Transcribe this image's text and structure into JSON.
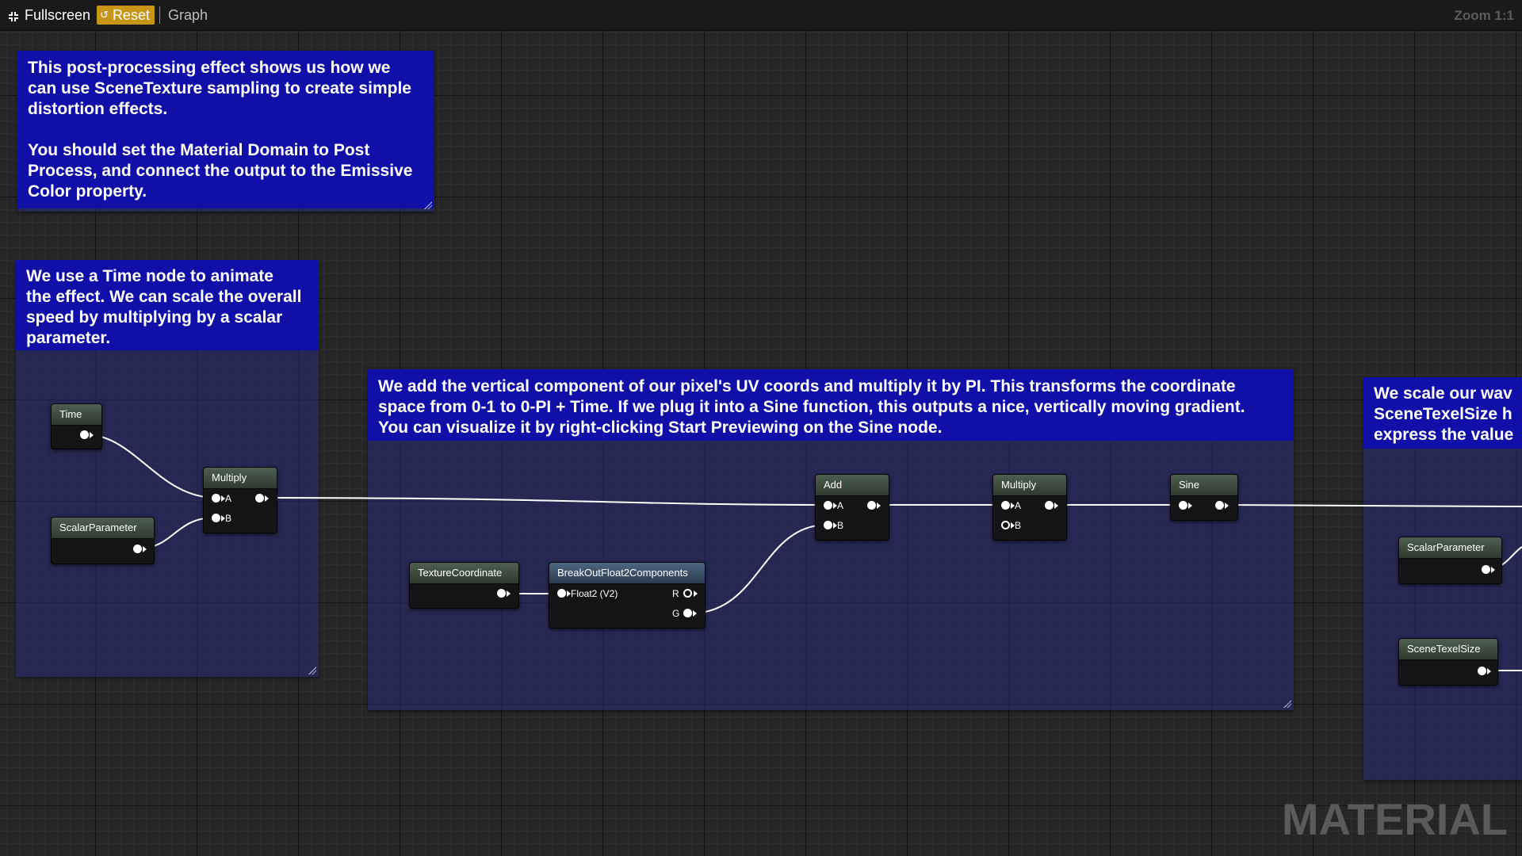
{
  "toolbar": {
    "fullscreen_label": "Fullscreen",
    "reset_label": "Reset",
    "graph_label": "Graph",
    "zoom_label": "Zoom 1:1"
  },
  "comments": {
    "intro": "This post-processing effect shows us how we\ncan use SceneTexture sampling to create simple\ndistortion effects.\n\nYou should set the Material Domain to Post\nProcess, and connect the output to the Emissive\nColor property.",
    "time": "We use a Time node to animate\nthe effect. We can scale the overall\nspeed by multiplying by a scalar\nparameter.",
    "vertical": "We add the vertical component of our pixel's UV coords and multiply it by PI. This transforms the coordinate\nspace from 0-1 to 0-PI + Time. If we plug it into a Sine function, this outputs a nice, vertically moving gradient.\nYou can visualize it by right-clicking Start Previewing on the Sine node.",
    "scale": "We scale our wav\nSceneTexelSize h\nexpress the value"
  },
  "nodes": {
    "time": {
      "title": "Time"
    },
    "scalar1": {
      "title": "ScalarParameter"
    },
    "multiply1": {
      "title": "Multiply",
      "pin_a": "A",
      "pin_b": "B"
    },
    "texcoord": {
      "title": "TextureCoordinate"
    },
    "breakout": {
      "title": "BreakOutFloat2Components",
      "input": "Float2 (V2)",
      "out_r": "R",
      "out_g": "G"
    },
    "add": {
      "title": "Add",
      "pin_a": "A",
      "pin_b": "B"
    },
    "multiply2": {
      "title": "Multiply",
      "pin_a": "A",
      "pin_b": "B"
    },
    "sine": {
      "title": "Sine"
    },
    "scalar2": {
      "title": "ScalarParameter"
    },
    "texelsize": {
      "title": "SceneTexelSize"
    }
  },
  "watermark": "MATERIAL",
  "colors": {
    "comment_header": "#1010a8",
    "reset_accent": "#c99514",
    "node_header": "#3c4a40",
    "node_header_blue": "#3a5068"
  },
  "icons": {
    "fullscreen": "fullscreen-icon",
    "reset": "reset-icon"
  }
}
